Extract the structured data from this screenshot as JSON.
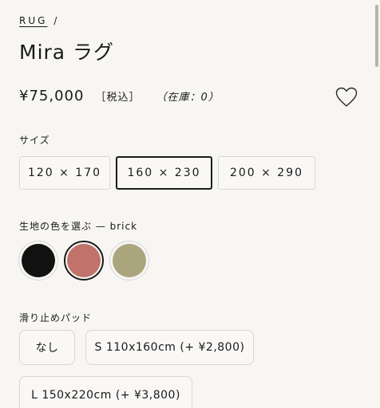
{
  "breadcrumb": {
    "category": "RUG",
    "separator": "/"
  },
  "product": {
    "title": "Mira ラグ",
    "price": "¥75,000",
    "tax_label": "［税込］",
    "stock_label": "（在庫：0）"
  },
  "size": {
    "label": "サイズ",
    "options": [
      "120 × 170",
      "160 × 230",
      "200 × 290"
    ],
    "selected_index": 1
  },
  "color": {
    "label": "生地の色を選ぶ — brick",
    "swatches": [
      {
        "name": "black",
        "hex": "#111111"
      },
      {
        "name": "brick",
        "hex": "#c1736a"
      },
      {
        "name": "olive",
        "hex": "#aaa57c"
      }
    ],
    "selected_index": 1
  },
  "pad": {
    "label": "滑り止めパッド",
    "options": [
      "なし",
      "S 110x160cm (+ ¥2,800)",
      "L 150x220cm (+ ¥3,800)"
    ]
  },
  "colors": {
    "border": "#d9d7d3",
    "text": "#1a1a1a",
    "background": "#f7f6f3"
  },
  "icons": {
    "favorite": "heart-outline-icon"
  }
}
